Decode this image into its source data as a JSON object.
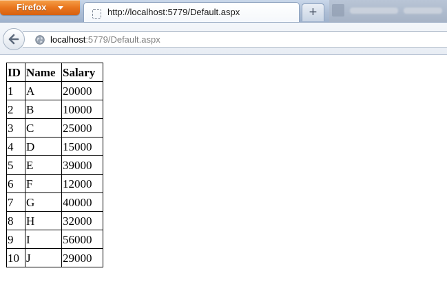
{
  "browser": {
    "menu_button": "Firefox",
    "tab_title": "http://localhost:5779/Default.aspx",
    "new_tab_label": "+",
    "address": {
      "host": "localhost",
      "path": ":5779/Default.aspx"
    }
  },
  "table": {
    "headers": [
      "ID",
      "Name",
      "Salary"
    ],
    "rows": [
      [
        "1",
        "A",
        "20000"
      ],
      [
        "2",
        "B",
        "10000"
      ],
      [
        "3",
        "C",
        "25000"
      ],
      [
        "4",
        "D",
        "15000"
      ],
      [
        "5",
        "E",
        "39000"
      ],
      [
        "6",
        "F",
        "12000"
      ],
      [
        "7",
        "G",
        "40000"
      ],
      [
        "8",
        "H",
        "32000"
      ],
      [
        "9",
        "I",
        "56000"
      ],
      [
        "10",
        "J",
        "29000"
      ]
    ]
  }
}
